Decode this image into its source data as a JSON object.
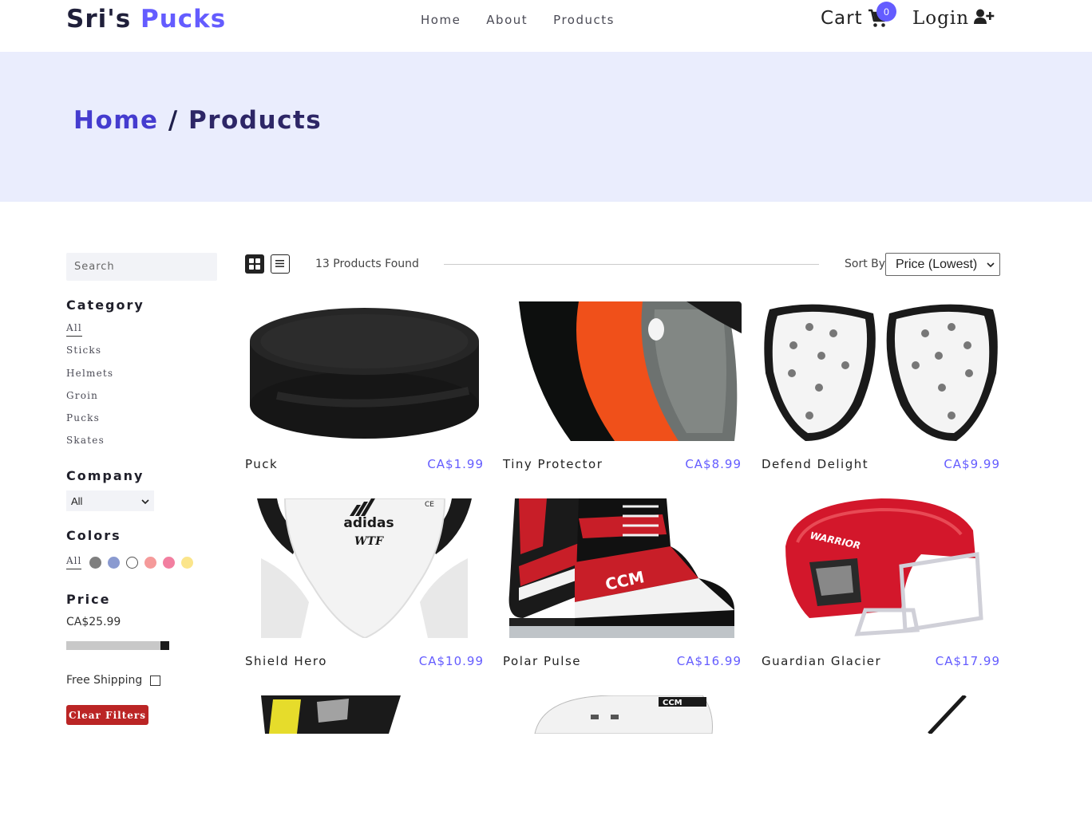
{
  "nav": {
    "logo_main": "Sri's",
    "logo_accent": "Pucks",
    "links": [
      "Home",
      "About",
      "Products"
    ],
    "cart_label": "Cart",
    "cart_count": "0",
    "login_label": "Login"
  },
  "hero": {
    "home": "Home",
    "separator": " / ",
    "current": "Products"
  },
  "filters": {
    "search_placeholder": "Search",
    "category_heading": "Category",
    "categories": [
      "All",
      "Sticks",
      "Helmets",
      "Groin",
      "Pucks",
      "Skates"
    ],
    "company_heading": "Company",
    "company_selected": "All",
    "colors_heading": "Colors",
    "colors_all": "All",
    "colors": [
      "#7f7f7f",
      "#8a9ad0",
      "#ffffff",
      "#f59a9a",
      "#f27fa0",
      "#fbe58b"
    ],
    "price_heading": "Price",
    "price_value": "CA$25.99",
    "price_fraction": 1.0,
    "shipping_label": "Free Shipping",
    "clear_label": "Clear Filters"
  },
  "products_header": {
    "found_text": "13 Products Found",
    "sort_label": "Sort By",
    "sort_selected": "Price (Lowest)"
  },
  "products": [
    {
      "name": "Puck",
      "price": "CA$1.99"
    },
    {
      "name": "Tiny Protector",
      "price": "CA$8.99"
    },
    {
      "name": "Defend Delight",
      "price": "CA$9.99"
    },
    {
      "name": "Shield Hero",
      "price": "CA$10.99"
    },
    {
      "name": "Polar Pulse",
      "price": "CA$16.99"
    },
    {
      "name": "Guardian Glacier",
      "price": "CA$17.99"
    }
  ],
  "product_image_text": {
    "groin_brand": "adidas",
    "groin_sub": "WTF",
    "skates_brand": "CCM",
    "helmet_brand": "WARRIOR",
    "helmet2_brand": "CCM"
  }
}
